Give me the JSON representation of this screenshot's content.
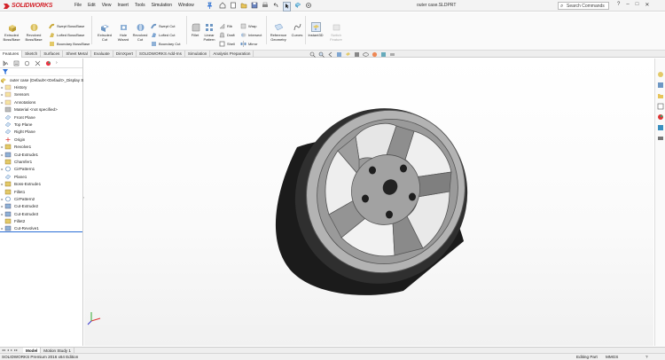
{
  "titlebar": {
    "brand": "SOLIDWORKS",
    "menus": [
      "File",
      "Edit",
      "View",
      "Insert",
      "Tools",
      "Simulation",
      "Window"
    ],
    "document_title": "outer case.SLDPRT",
    "search_placeholder": "Search Commands"
  },
  "commands": {
    "extruded_boss": "Extruded Boss/Base",
    "revolved_boss": "Revolved Boss/Base",
    "swept_boss": "Swept Boss/Base",
    "lofted_boss": "Lofted Boss/Base",
    "boundary_boss": "Boundary Boss/Base",
    "extruded_cut": "Extruded Cut",
    "hole_wizard": "Hole Wizard",
    "revolved_cut": "Revolved Cut",
    "swept_cut": "Swept Cut",
    "lofted_cut": "Lofted Cut",
    "boundary_cut": "Boundary Cut",
    "fillet": "Fillet",
    "linear_pattern": "Linear Pattern",
    "rib": "Rib",
    "draft": "Draft",
    "shell": "Shell",
    "wrap": "Wrap",
    "intersect": "Intersect",
    "mirror": "Mirror",
    "reference_geometry": "Reference Geometry",
    "curves": "Curves",
    "instant3d": "Instant3D",
    "rapid_sketch": "Rapid Sketch",
    "sketch_feature": "Switch Feature"
  },
  "tabs": [
    "Features",
    "Sketch",
    "Surfaces",
    "Sheet Metal",
    "Evaluate",
    "DimXpert",
    "SOLIDWORKS Add-Ins",
    "Simulation",
    "Analysis Preparation"
  ],
  "tree": {
    "root": "outer case (Default<<Default>_Display S",
    "items": [
      "History",
      "Sensors",
      "Annotations",
      "Material <not specified>",
      "Front Plane",
      "Top Plane",
      "Right Plane",
      "Origin",
      "Revolve1",
      "Cut-Extrude1",
      "Chamfer1",
      "CirPattern1",
      "Plane1",
      "Boss-Extrude1",
      "Fillet1",
      "CirPattern2",
      "Cut-Extrude2",
      "Cut-Extrude3",
      "Fillet2",
      "Cut-Revolve1"
    ]
  },
  "bottom_tabs": [
    "Model",
    "Motion Study 1"
  ],
  "status": {
    "left": "SOLIDWORKS Premium 2016 x64 Edition",
    "mode": "Editing Part",
    "units": "MMGS",
    "help": "?"
  },
  "colors": {
    "brand_red": "#d3232a",
    "selection_blue": "#2b6ed6",
    "part_gray": "#9a9a9a",
    "tire_black": "#1b1b1b"
  }
}
